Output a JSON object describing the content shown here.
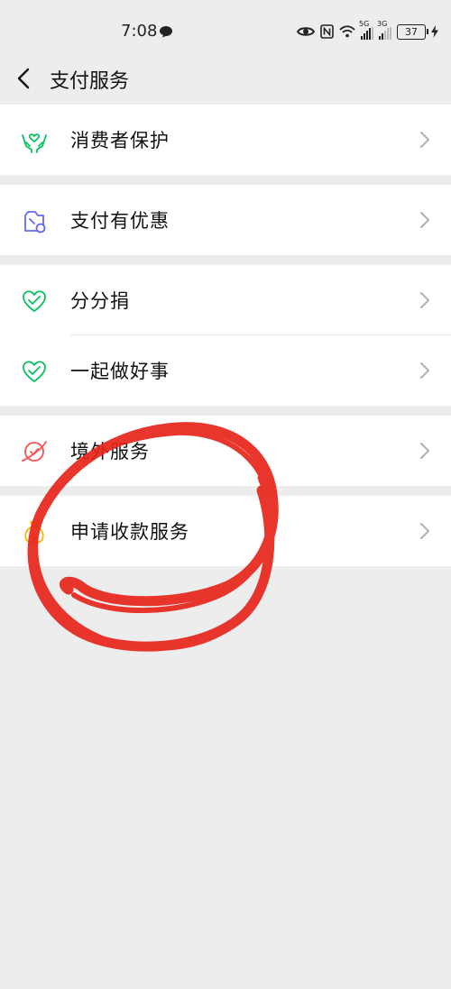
{
  "status_bar": {
    "time": "7:08",
    "network_1": "5G",
    "network_2": "3G",
    "battery": "37"
  },
  "nav": {
    "title": "支付服务"
  },
  "groups": [
    {
      "items": [
        {
          "label": "消费者保护",
          "icon": "hands-heart-icon"
        }
      ]
    },
    {
      "items": [
        {
          "label": "支付有优惠",
          "icon": "coupon-icon"
        }
      ]
    },
    {
      "items": [
        {
          "label": "分分捐",
          "icon": "charity-heart-icon"
        },
        {
          "label": "一起做好事",
          "icon": "charity-heart-icon"
        }
      ]
    },
    {
      "items": [
        {
          "label": "境外服务",
          "icon": "globe-icon"
        }
      ]
    },
    {
      "items": [
        {
          "label": "申请收款服务",
          "icon": "money-bag-icon"
        }
      ]
    }
  ],
  "colors": {
    "page_bg": "#ededed",
    "green": "#07c160",
    "purple": "#6467f0",
    "red_icon": "#fa5151",
    "yellow": "#f6b800",
    "annotation": "#e8261b"
  }
}
